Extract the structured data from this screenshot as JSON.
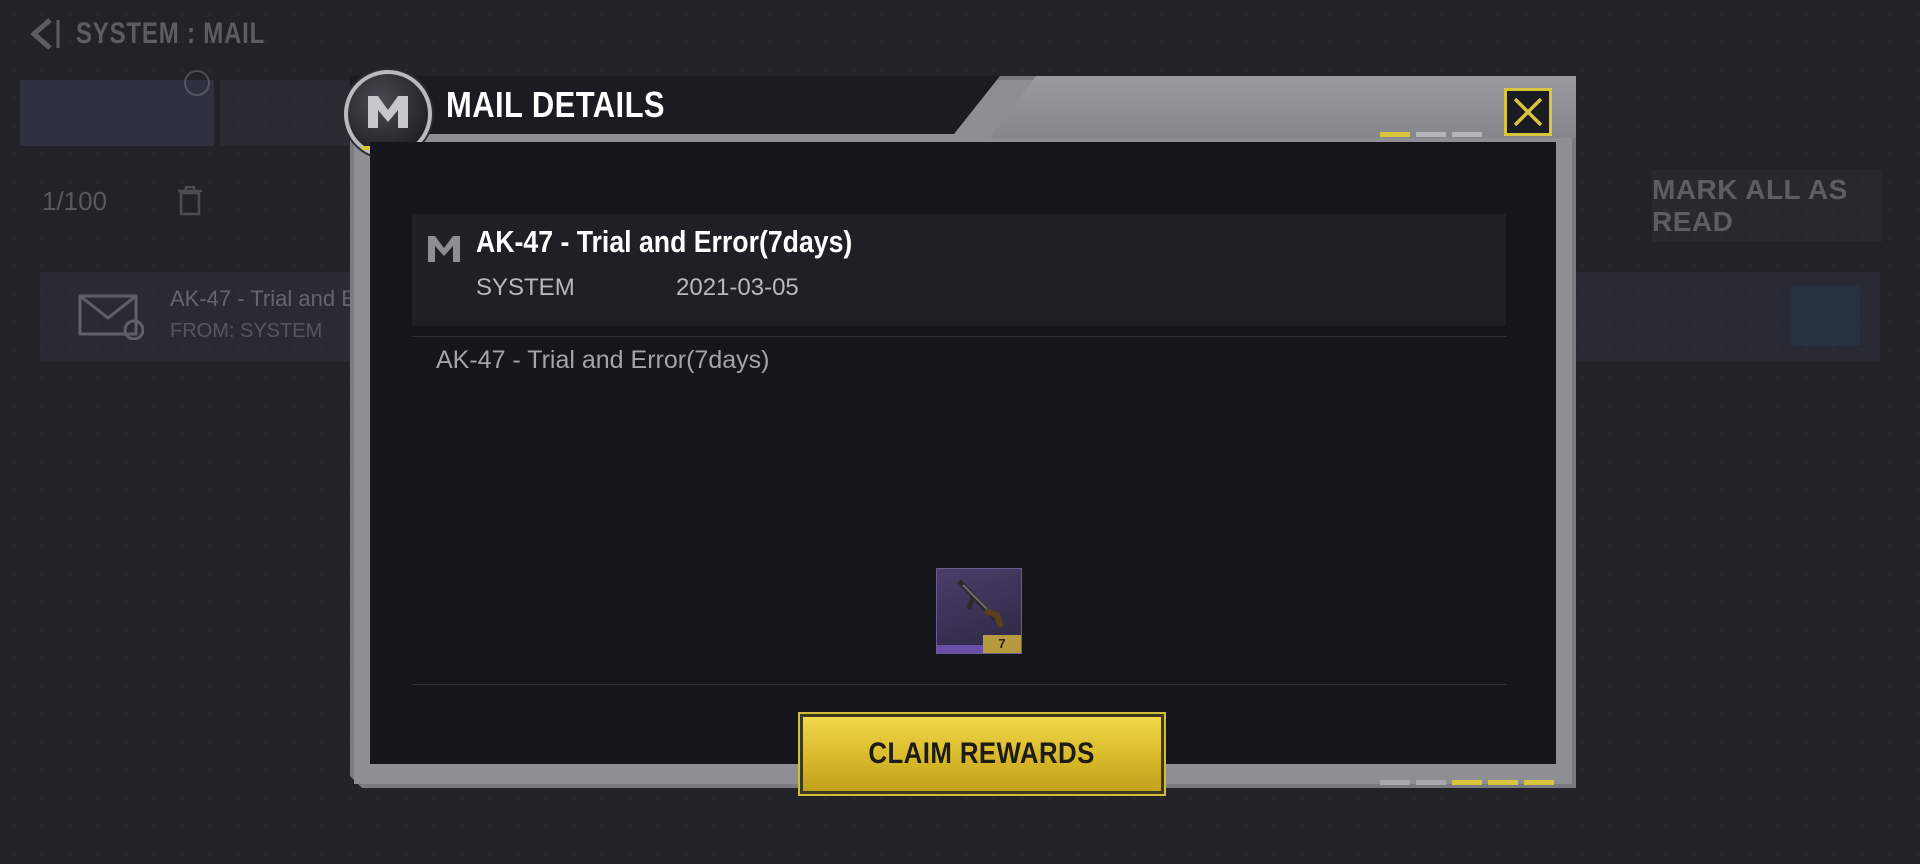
{
  "background": {
    "title": "SYSTEM : MAIL",
    "mark_all_read_label": "MARK ALL AS READ",
    "count_text": "1/100",
    "mail_row": {
      "title": "AK-47 - Trial and E",
      "subtitle": "FROM: SYSTEM"
    }
  },
  "dialog": {
    "title": "MAIL DETAILS",
    "close_icon": "close-x-icon",
    "emblem_icon": "mail-m-icon"
  },
  "mail": {
    "subject": "AK-47 - Trial and Error(7days)",
    "sender": "SYSTEM",
    "date": "2021-03-05",
    "body": "AK-47 - Trial and Error(7days)",
    "reward": {
      "icon": "ak47-weapon-icon",
      "tag": "7"
    }
  },
  "actions": {
    "claim_label": "CLAIM REWARDS"
  },
  "colors": {
    "accent": "#d8c53b",
    "panel": "#15161b",
    "frame": "#8e8f95"
  }
}
